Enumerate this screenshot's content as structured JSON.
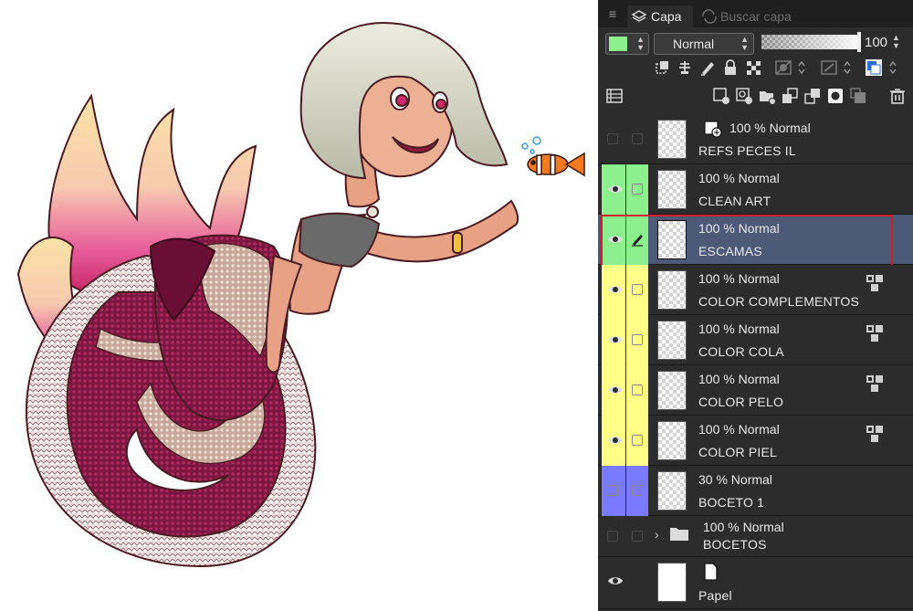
{
  "tabs": {
    "active_label": "Capa",
    "inactive_label": "Buscar capa"
  },
  "properties": {
    "blend_mode": "Normal",
    "opacity": "100",
    "opacity_fraction": 1.0,
    "layer_color": "#8cf08c"
  },
  "layers": [
    {
      "mode": "100 % Normal",
      "name": "REFS PECES IL",
      "visible": false,
      "color": "none",
      "type": "image"
    },
    {
      "mode": "100 % Normal",
      "name": "CLEAN ART",
      "visible": true,
      "color": "#8cf08c",
      "type": "raster"
    },
    {
      "mode": "100 % Normal",
      "name": "ESCAMAS",
      "visible": true,
      "color": "#8cf08c",
      "type": "raster",
      "selected": true,
      "editing": true
    },
    {
      "mode": "100 % Normal",
      "name": "COLOR COMPLEMENTOS",
      "visible": true,
      "color": "#ffff88",
      "type": "raster",
      "clipping": true
    },
    {
      "mode": "100 % Normal",
      "name": "COLOR COLA",
      "visible": true,
      "color": "#ffff88",
      "type": "raster",
      "clipping": true
    },
    {
      "mode": "100 % Normal",
      "name": "COLOR PELO",
      "visible": true,
      "color": "#ffff88",
      "type": "raster",
      "clipping": true
    },
    {
      "mode": "100 % Normal",
      "name": "COLOR PIEL",
      "visible": true,
      "color": "#ffff88",
      "type": "raster",
      "clipping": true
    },
    {
      "mode": "30 % Normal",
      "name": "BOCETO 1",
      "visible": false,
      "color": "#7a7aff",
      "type": "raster"
    },
    {
      "mode": "100 % Normal",
      "name": "BOCETOS",
      "visible": false,
      "color": "none",
      "type": "folder"
    },
    {
      "mode": "",
      "name": "Papel",
      "visible": true,
      "color": "none",
      "type": "paper"
    }
  ],
  "colors": {
    "panel_bg": "#2c2c2c",
    "selected_row": "#4c5a78",
    "selection_outline": "#d0202a",
    "green_tag": "#8cf08c",
    "yellow_tag": "#ffff88",
    "blue_tag": "#7a7aff"
  }
}
